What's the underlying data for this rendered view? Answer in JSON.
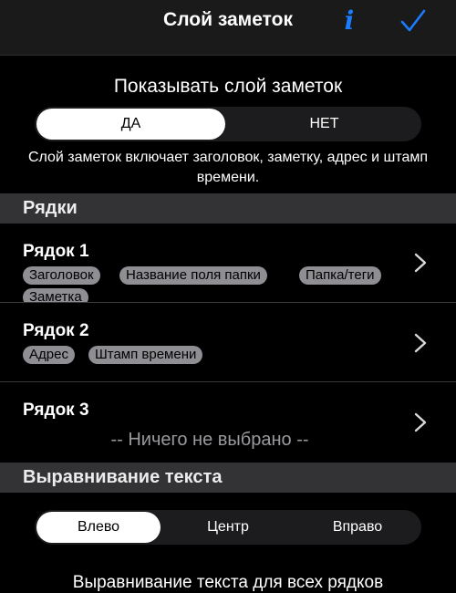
{
  "header": {
    "title": "Слой заметок",
    "info_icon": "info-icon",
    "done_icon": "checkmark-icon",
    "accent": "#1a7cff"
  },
  "show_layer": {
    "title": "Показывать слой заметок",
    "options": [
      "ДА",
      "НЕТ"
    ],
    "selected": "ДА",
    "description": "Слой заметок включает заголовок, заметку, адрес и штамп времени."
  },
  "rows_section": {
    "title": "Рядки",
    "rows": [
      {
        "title": "Рядок 1",
        "chips": [
          "Заголовок",
          "Название поля папки",
          "Папка/теги",
          "Заметка"
        ]
      },
      {
        "title": "Рядок 2",
        "chips": [
          "Адрес",
          "Штамп времени"
        ]
      },
      {
        "title": "Рядок 3",
        "empty_text": "-- Ничего не выбрано --"
      }
    ]
  },
  "alignment_section": {
    "title": "Выравнивание текста",
    "options": [
      "Влево",
      "Центр",
      "Вправо"
    ],
    "selected": "Влево",
    "partial_text": "Выравнивание текста для всех рядков"
  }
}
